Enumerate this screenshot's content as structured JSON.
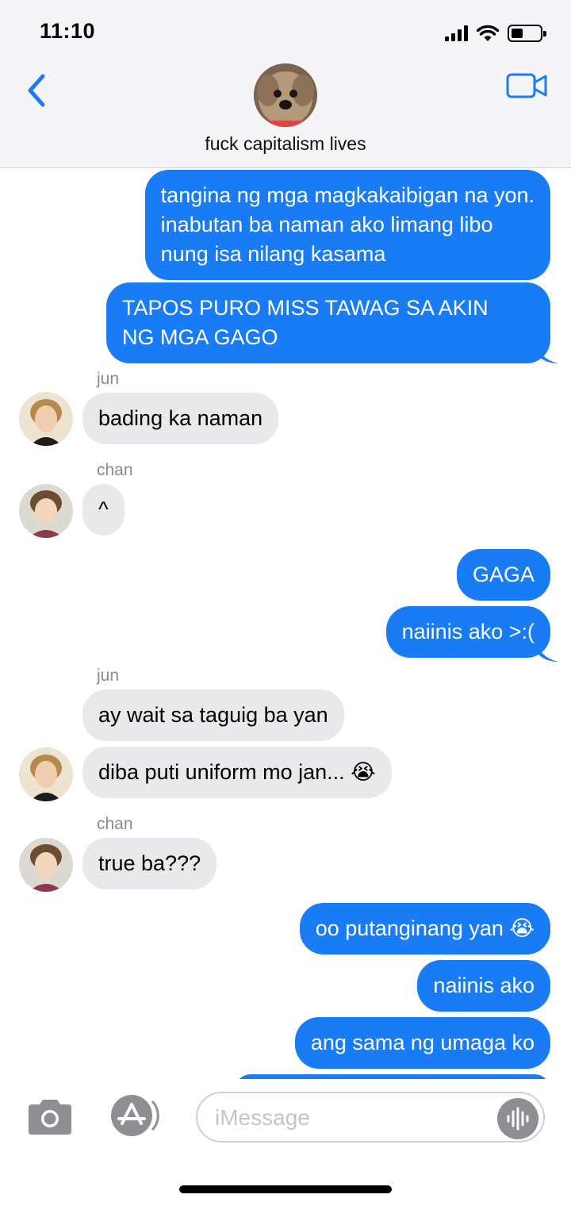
{
  "status": {
    "time": "11:10"
  },
  "header": {
    "contact_name": "fuck capitalism lives",
    "accent": "#1a7cf5"
  },
  "messages": [
    {
      "from": "me",
      "lines": [
        "tangina ng mga magkakaibigan na yon.",
        "inabutan ba naman ako limang libo",
        "nung isa nilang kasama"
      ]
    },
    {
      "from": "me",
      "lines": [
        "TAPOS PURO MISS TAWAG SA AKIN",
        "NG MGA GAGO"
      ]
    },
    {
      "from": "jun",
      "sender_label": "jun",
      "text": "bading ka naman"
    },
    {
      "from": "chan",
      "sender_label": "chan",
      "text": "^"
    },
    {
      "from": "me",
      "text": "GAGA"
    },
    {
      "from": "me",
      "text": "naiinis ako >:("
    },
    {
      "from": "jun",
      "sender_label": "jun",
      "text": "ay wait sa taguig ba yan"
    },
    {
      "from": "jun",
      "text": "diba puti uniform mo jan... 😭"
    },
    {
      "from": "chan",
      "sender_label": "chan",
      "text": "true ba???"
    },
    {
      "from": "me",
      "text": "oo putanginang yan 😭"
    },
    {
      "from": "me",
      "text": "naiinis ako"
    },
    {
      "from": "me",
      "text": "ang sama ng umaga ko"
    }
  ],
  "input": {
    "placeholder": "iMessage"
  },
  "colors": {
    "outgoing": "#1a7cf5",
    "incoming": "#e9e9eb",
    "header_bg": "#f5f5f7"
  },
  "icons": [
    "back-chevron-icon",
    "video-camera-icon",
    "camera-icon",
    "app-store-icon",
    "audio-waveform-icon"
  ]
}
